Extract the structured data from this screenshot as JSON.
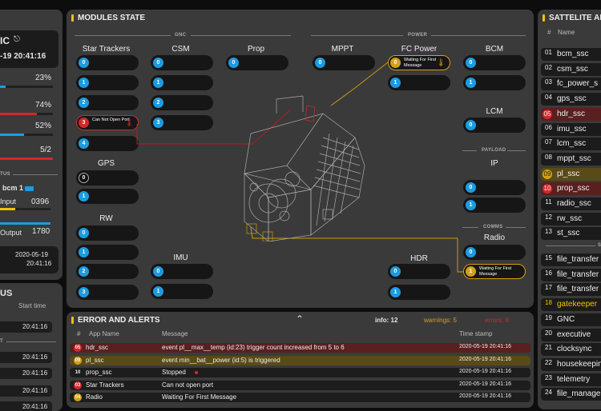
{
  "left_top": {
    "title": "IC",
    "datetime": "-19 20:41:16",
    "stats": [
      {
        "value": "23%",
        "fill": 0.23,
        "color": "#1e9be0"
      },
      {
        "value": "74%",
        "fill": 0.74,
        "color": "#d02a2a"
      },
      {
        "value": "52%",
        "fill": 0.52,
        "color": "#1e9be0"
      },
      {
        "value": "5/2",
        "fill": 1,
        "color": "#d02a2a"
      }
    ],
    "sec_label": "TUS",
    "bcm_label": "bcm 1",
    "input_label": "Input",
    "input_value": "0396",
    "output_label": "Output",
    "output_value": "1780",
    "stamp_date": "2020-05-19",
    "stamp_time": "20:41:16"
  },
  "left_bottom": {
    "title": "US",
    "start_label": "Start time",
    "times": [
      "20:41:16",
      "20:41:16",
      "20:41:16",
      "20:41:16",
      "20:41:16"
    ],
    "sep": "T"
  },
  "modules": {
    "title": "MODULES STATE",
    "sections": {
      "gnc": "GNC",
      "power": "POWER",
      "payload": "PAYLOAD",
      "comms": "COMMS"
    },
    "labels": {
      "star_trackers": "Star Trackers",
      "csm": "CSM",
      "prop": "Prop",
      "mppt": "MPPT",
      "fc_power": "FC Power",
      "bcm": "BCM",
      "gps": "GPS",
      "lcm": "LCM",
      "ip": "IP",
      "rw": "RW",
      "imu": "IMU",
      "hdr": "HDR",
      "radio": "Radio"
    },
    "star_trackers": [
      "0",
      "1",
      "2",
      "3",
      "4"
    ],
    "star_err_text": "Can Not Open Port",
    "csm": [
      "0",
      "1",
      "2",
      "3"
    ],
    "prop": [
      "0"
    ],
    "mppt": [
      "0"
    ],
    "fc_power": [
      "0",
      "1"
    ],
    "fc_warn_text": "Waiting For First Message",
    "bcm": [
      "0",
      "1"
    ],
    "gps": [
      "0",
      "1"
    ],
    "lcm": [
      "0"
    ],
    "ip": [
      "0",
      "1"
    ],
    "rw": [
      "0",
      "1",
      "2",
      "3"
    ],
    "imu": [
      "0",
      "1"
    ],
    "hdr": [
      "0",
      "1"
    ],
    "radio": [
      "0",
      "1"
    ],
    "radio_warn_text": "Waiting For First Message"
  },
  "errors": {
    "title": "ERROR AND ALERTS",
    "info": "info: 12",
    "warnings": "warnings: 5",
    "errors_count": "errors: 8",
    "cols": {
      "no": "#",
      "app": "App Name",
      "msg": "Message",
      "ts": "Time stamp"
    },
    "rows": [
      {
        "no": "05",
        "app": "hdr_ssc",
        "msg": "event pl__max__temp (id:23) trigger count increased from 5 to 6",
        "ts": "2020-05-19 20:41:16",
        "type": "err"
      },
      {
        "no": "09",
        "app": "pl_ssc",
        "msg": "event min__bat__power (id:5) is triggered",
        "ts": "2020-05-19 20:41:16",
        "type": "warn"
      },
      {
        "no": "10",
        "app": "prop_ssc",
        "msg": "Stopped",
        "ts": "2020-05-19 20:41:16",
        "type": "normal"
      },
      {
        "no": "03",
        "app": "Star Trackers",
        "msg": "Can not open port",
        "ts": "2020-05-19 20:41:16",
        "type": "normal"
      },
      {
        "no": "04",
        "app": "Radio",
        "msg": "Waiting For First Message",
        "ts": "2020-05-19 20:41:16",
        "type": "normal"
      }
    ]
  },
  "apps": {
    "title": "SATTELITE AP",
    "col_no": "#",
    "col_name": "Name",
    "sep": "S",
    "list": [
      {
        "n": "01",
        "name": "bcm_ssc",
        "t": ""
      },
      {
        "n": "02",
        "name": "csm_ssc",
        "t": ""
      },
      {
        "n": "03",
        "name": "fc_power_s",
        "t": ""
      },
      {
        "n": "04",
        "name": "gps_ssc",
        "t": ""
      },
      {
        "n": "05",
        "name": "hdr_ssc",
        "t": "err"
      },
      {
        "n": "06",
        "name": "imu_ssc",
        "t": ""
      },
      {
        "n": "07",
        "name": "lcm_ssc",
        "t": ""
      },
      {
        "n": "08",
        "name": "mppt_ssc",
        "t": ""
      },
      {
        "n": "09",
        "name": "pl_ssc",
        "t": "warn"
      },
      {
        "n": "10",
        "name": "prop_ssc",
        "t": "err"
      },
      {
        "n": "11",
        "name": "radio_ssc",
        "t": ""
      },
      {
        "n": "12",
        "name": "rw_ssc",
        "t": ""
      },
      {
        "n": "13",
        "name": "st_ssc",
        "t": ""
      }
    ],
    "list2": [
      {
        "n": "15",
        "name": "file_transfer",
        "t": ""
      },
      {
        "n": "16",
        "name": "file_transfer",
        "t": ""
      },
      {
        "n": "17",
        "name": "file_transfer",
        "t": ""
      },
      {
        "n": "18",
        "name": "gatekeeper",
        "t": "hl"
      },
      {
        "n": "19",
        "name": "GNC",
        "t": ""
      },
      {
        "n": "20",
        "name": "executive",
        "t": ""
      },
      {
        "n": "21",
        "name": "clocksync",
        "t": ""
      },
      {
        "n": "22",
        "name": "housekeeping",
        "t": ""
      },
      {
        "n": "23",
        "name": "telemetry",
        "t": ""
      },
      {
        "n": "24",
        "name": "file_manage",
        "t": ""
      }
    ]
  }
}
